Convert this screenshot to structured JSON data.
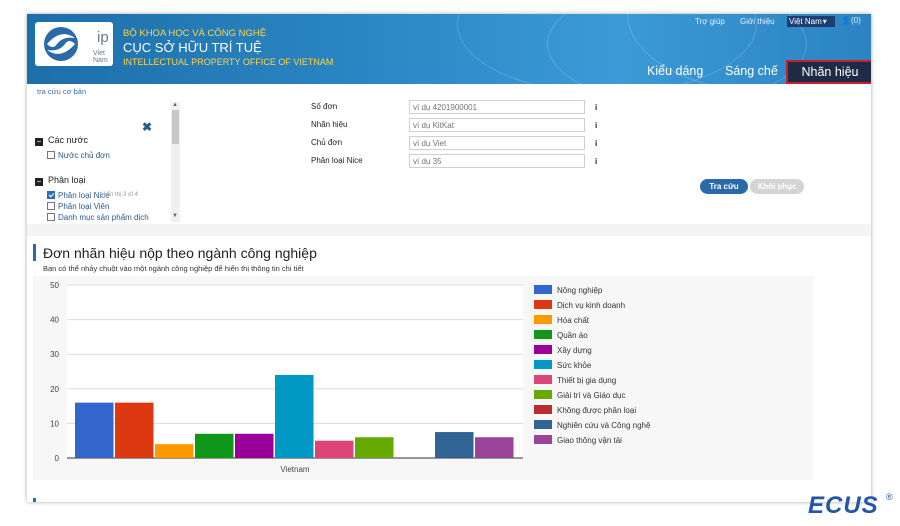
{
  "header": {
    "logo_ip": "ip",
    "logo_vn": "Viet Nam",
    "line1": "BỘ KHOA HỌC VÀ CÔNG NGHỆ",
    "line2": "CỤC SỞ HỮU TRÍ TUỆ",
    "line3": "INTELLECTUAL PROPERTY OFFICE OF VIETNAM",
    "links": [
      "Trợ giúp",
      "Giới thiệu"
    ],
    "language": "Việt Nam",
    "user": "(0)",
    "tabs": [
      "Kiểu dáng",
      "Sáng chế",
      "Nhãn hiệu"
    ],
    "active_tab": "Nhãn hiệu"
  },
  "breadcrumb": "tra cứu cơ bản",
  "filters": {
    "section1": "Các nước",
    "section1_items": [
      {
        "label": "Nước chủ đơn",
        "checked": false
      }
    ],
    "section2": "Phân loại",
    "section2_hint": "Hiển thị 3 of 4",
    "section2_items": [
      {
        "label": "Phân loại Nice",
        "checked": true
      },
      {
        "label": "Phân loại Viên",
        "checked": false
      },
      {
        "label": "Danh mục sản phẩm dịch",
        "checked": false
      }
    ]
  },
  "form": {
    "fields": [
      {
        "label": "Số đơn",
        "placeholder": "ví dụ 4201900001"
      },
      {
        "label": "Nhãn hiệu",
        "placeholder": "ví dụ KitKat"
      },
      {
        "label": "Chủ đơn",
        "placeholder": "ví dụ Viet"
      },
      {
        "label": "Phân loại Nice",
        "placeholder": "ví dụ 35"
      }
    ],
    "info_glyph": "i",
    "search_button": "Tra cứu",
    "reset_button": "Khôi phục"
  },
  "chart_section": {
    "title": "Đơn nhãn hiệu nộp theo ngành công nghiệp",
    "subtitle": "Bạn có thể nháy chuột vào một ngành công nghiệp để hiển thị thông tin chi tiết"
  },
  "chart_data": {
    "type": "bar",
    "categories": [
      "Vietnam"
    ],
    "ylim": [
      0,
      50
    ],
    "yticks": [
      0,
      10,
      20,
      30,
      40,
      50
    ],
    "grid": true,
    "legend_position": "right",
    "series": [
      {
        "name": "Nông nghiệp",
        "values": [
          16
        ],
        "color": "#3366cc"
      },
      {
        "name": "Dịch vụ kinh doanh",
        "values": [
          16
        ],
        "color": "#dc3912"
      },
      {
        "name": "Hóa chất",
        "values": [
          4
        ],
        "color": "#ff9900"
      },
      {
        "name": "Quần áo",
        "values": [
          7
        ],
        "color": "#109618"
      },
      {
        "name": "Xây dựng",
        "values": [
          7
        ],
        "color": "#990099"
      },
      {
        "name": "Sức khỏe",
        "values": [
          24
        ],
        "color": "#0099c6"
      },
      {
        "name": "Thiết bị gia dụng",
        "values": [
          5
        ],
        "color": "#dd4477"
      },
      {
        "name": "Giải trí và Giáo dục",
        "values": [
          6
        ],
        "color": "#66aa00"
      },
      {
        "name": "Không được phân loại",
        "values": [
          0
        ],
        "color": "#b82e2e"
      },
      {
        "name": "Nghiên cứu và Công nghệ",
        "values": [
          7.5
        ],
        "color": "#316395"
      },
      {
        "name": "Giao thông vận tải",
        "values": [
          6
        ],
        "color": "#994499"
      }
    ]
  },
  "watermark": {
    "text": "ECUS",
    "reg": "®"
  }
}
